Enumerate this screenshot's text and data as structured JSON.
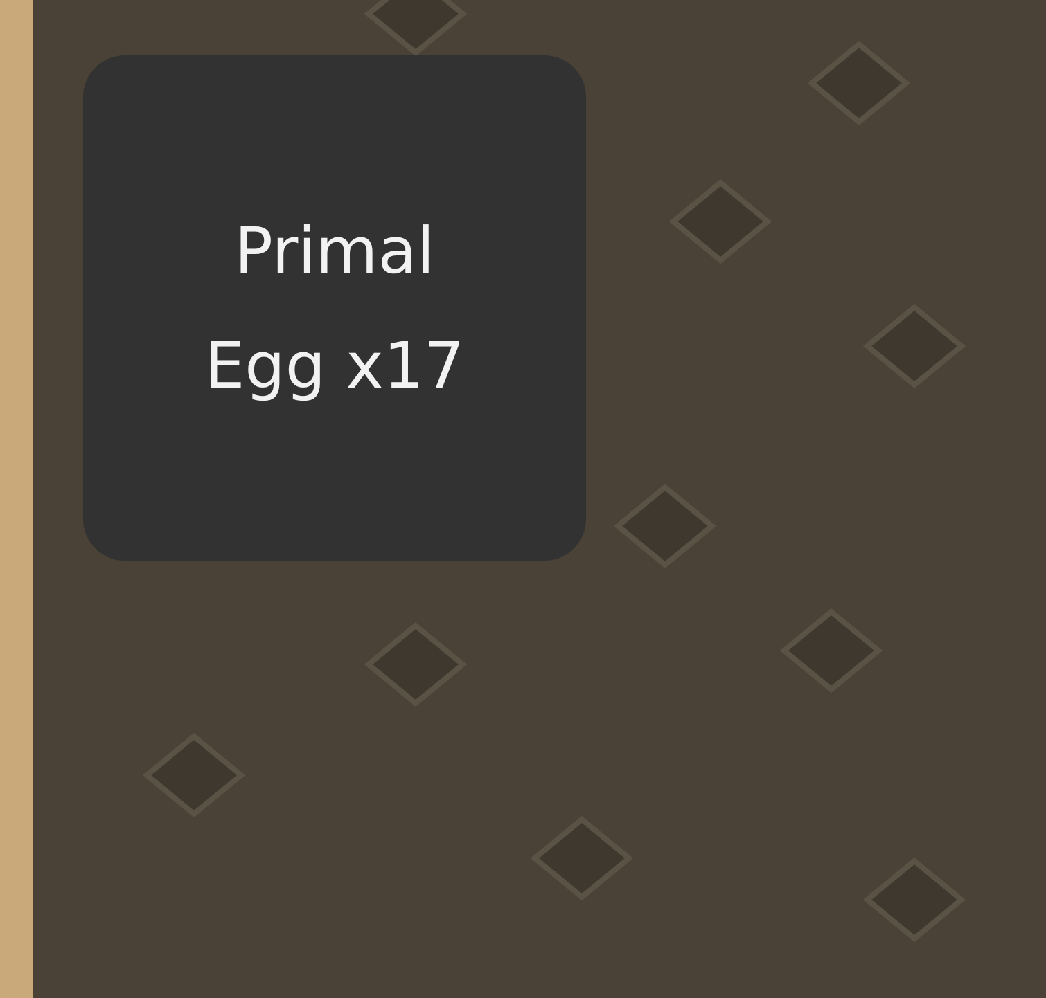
{
  "tooltip": {
    "text": "Primal Egg x17"
  }
}
